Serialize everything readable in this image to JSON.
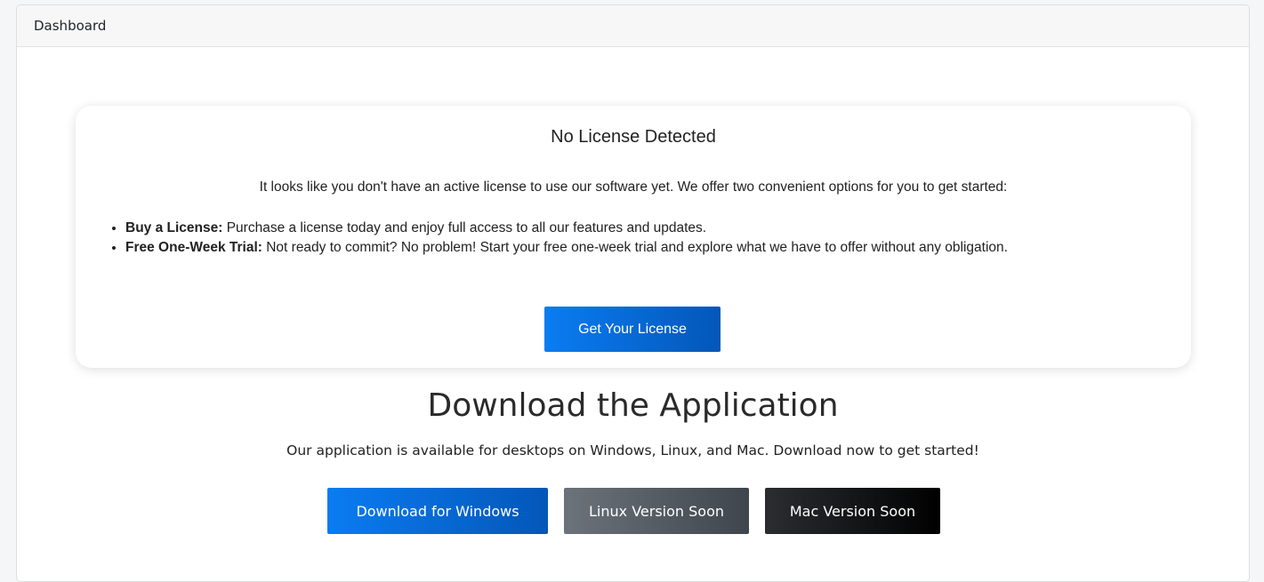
{
  "header": {
    "title": "Dashboard"
  },
  "license": {
    "title": "No License Detected",
    "description": "It looks like you don't have an active license to use our software yet. We offer two convenient options for you to get started:",
    "options": [
      {
        "label": "Buy a License:",
        "text": " Purchase a license today and enjoy full access to all our features and updates."
      },
      {
        "label": "Free One-Week Trial:",
        "text": " Not ready to commit? No problem! Start your free one-week trial and explore what we have to offer without any obligation."
      }
    ],
    "button_label": "Get Your License"
  },
  "download": {
    "title": "Download the Application",
    "description": "Our application is available for desktops on Windows, Linux, and Mac. Download now to get started!",
    "buttons": {
      "windows": "Download for Windows",
      "linux": "Linux Version Soon",
      "mac": "Mac Version Soon"
    }
  },
  "colors": {
    "primary": "#0a7cf2",
    "secondary": "#6c737b",
    "dark": "#000000"
  }
}
